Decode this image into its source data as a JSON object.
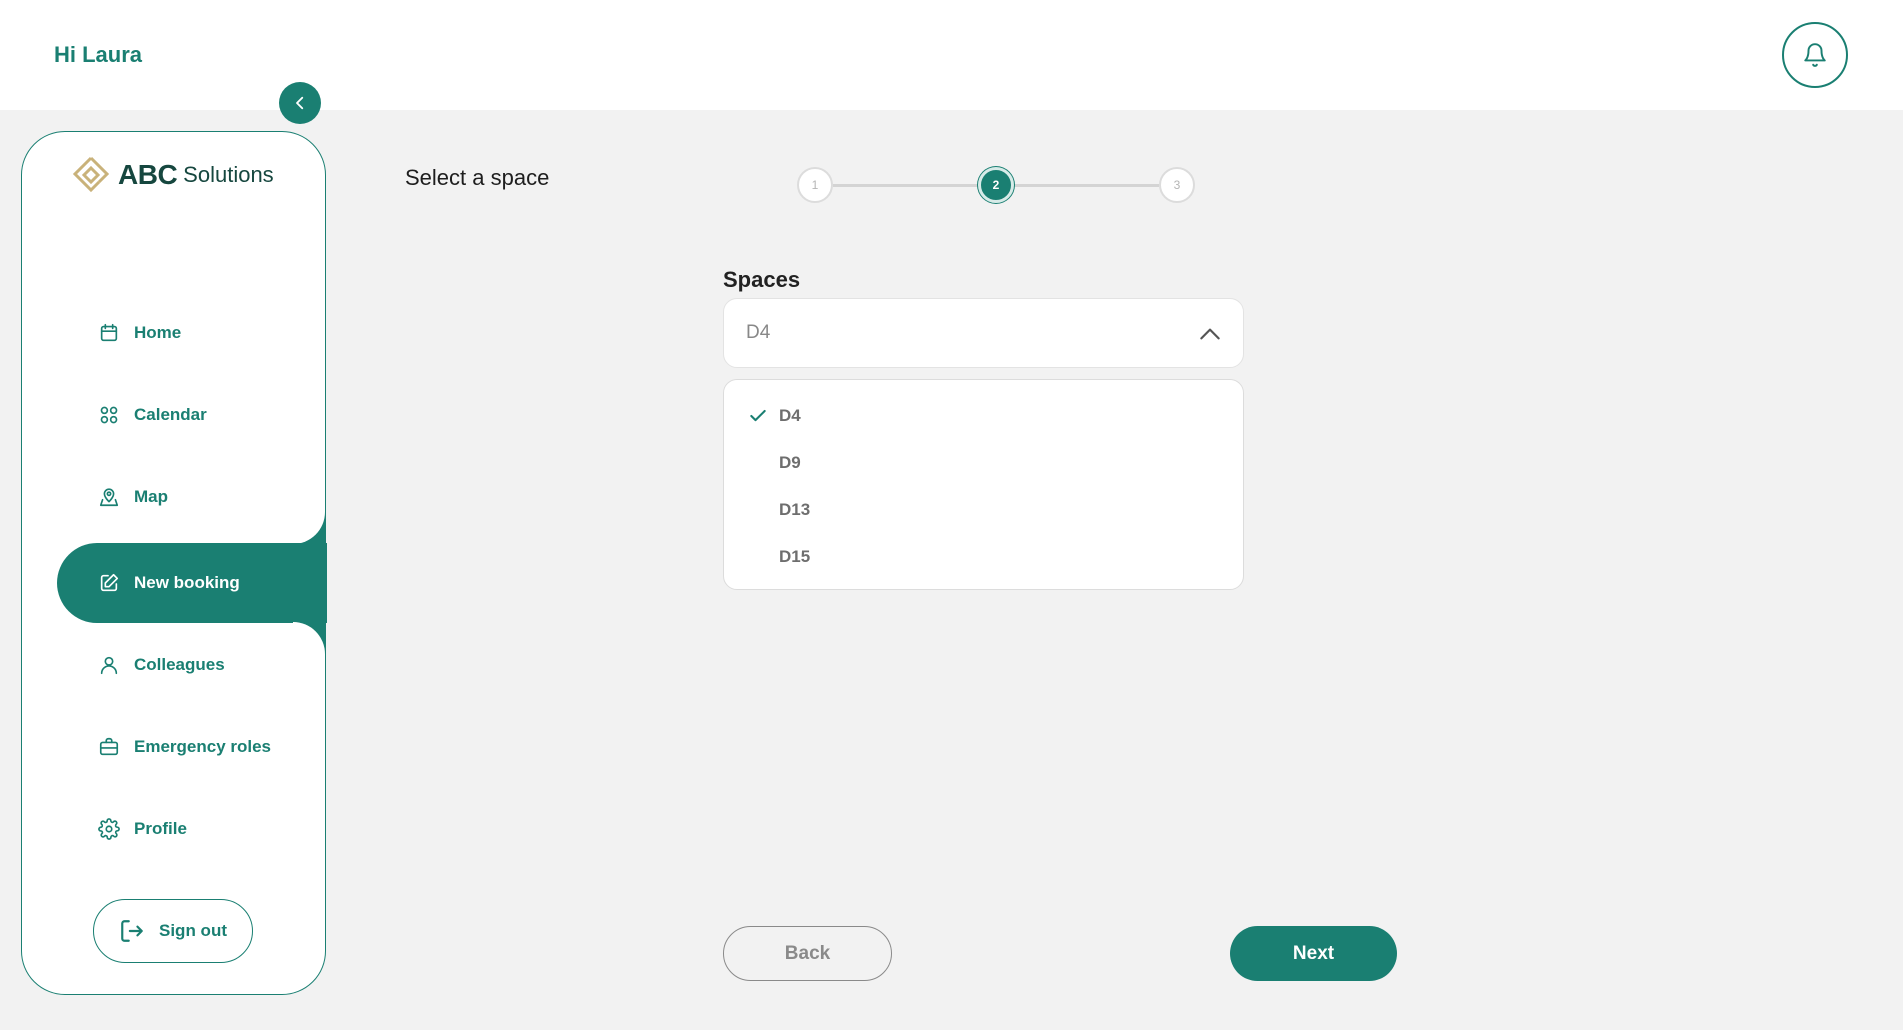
{
  "header": {
    "greeting": "Hi Laura",
    "bell_icon": "bell-icon"
  },
  "sidebar": {
    "logo": {
      "bold": "ABC",
      "rest": "Solutions",
      "mark_color": "#c9b27a"
    },
    "collapse_icon": "chevron-left-icon",
    "items": [
      {
        "label": "Home",
        "icon": "calendar-icon",
        "active": false
      },
      {
        "label": "Calendar",
        "icon": "grid-icon",
        "active": false
      },
      {
        "label": "Map",
        "icon": "map-pin-icon",
        "active": false
      },
      {
        "label": "New booking",
        "icon": "edit-icon",
        "active": true
      },
      {
        "label": "Colleagues",
        "icon": "user-icon",
        "active": false
      },
      {
        "label": "Emergency roles",
        "icon": "briefcase-icon",
        "active": false
      },
      {
        "label": "Profile",
        "icon": "gear-icon",
        "active": false
      }
    ],
    "signout_label": "Sign out"
  },
  "main": {
    "title": "Select a space",
    "stepper": {
      "steps": [
        "1",
        "2",
        "3"
      ],
      "current": 2
    },
    "spaces": {
      "label": "Spaces",
      "selected": "D4",
      "options": [
        "D4",
        "D9",
        "D13",
        "D15"
      ]
    },
    "back_label": "Back",
    "next_label": "Next"
  },
  "colors": {
    "accent": "#1a7f72",
    "background": "#f2f2f2"
  }
}
